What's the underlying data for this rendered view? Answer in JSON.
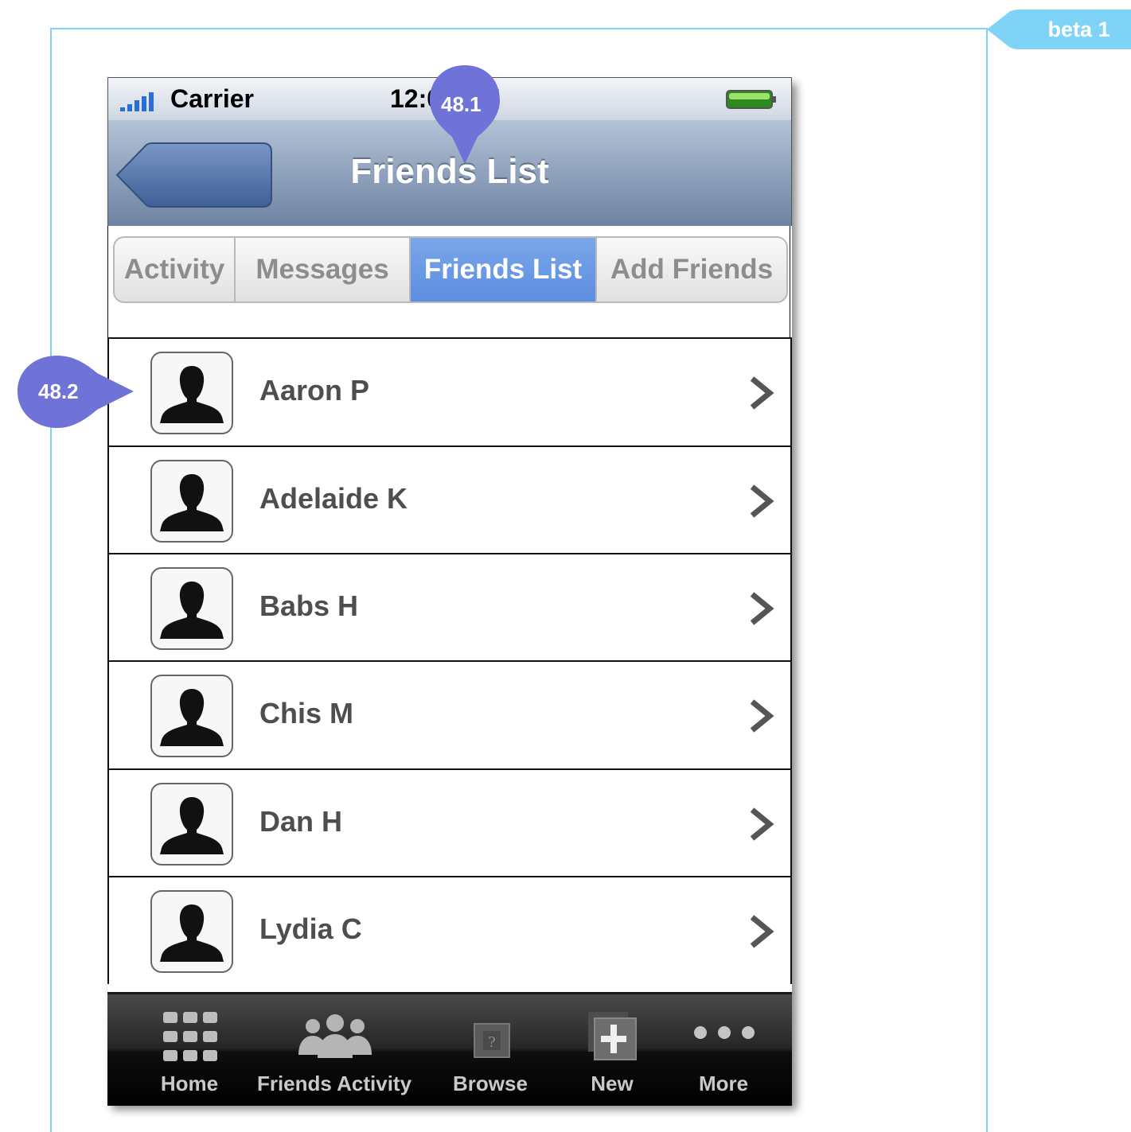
{
  "annotation": {
    "version_tag": "beta 1",
    "callouts": [
      "48.1",
      "48.2"
    ],
    "frame_color": "#7fd3f7",
    "callout_color": "#6f73d8"
  },
  "status_bar": {
    "carrier": "Carrier",
    "time": "12:00 PM"
  },
  "nav_bar": {
    "title": "Friends List",
    "back_icon": "back-arrow-button"
  },
  "segmented_control": {
    "segments": [
      "Activity",
      "Messages",
      "Friends List",
      "Add Friends"
    ],
    "selected": "Friends List"
  },
  "friends": [
    "Aaron P",
    "Adelaide K",
    "Babs H",
    "Chis M",
    "Dan H",
    "Lydia C"
  ],
  "tab_bar": {
    "items": [
      {
        "label": "Home",
        "icon": "grid-icon"
      },
      {
        "label": "Friends Activity",
        "icon": "people-icon"
      },
      {
        "label": "Browse",
        "icon": "question-box-icon"
      },
      {
        "label": "New",
        "icon": "new-plus-icon"
      },
      {
        "label": "More",
        "icon": "more-dots-icon"
      }
    ]
  }
}
